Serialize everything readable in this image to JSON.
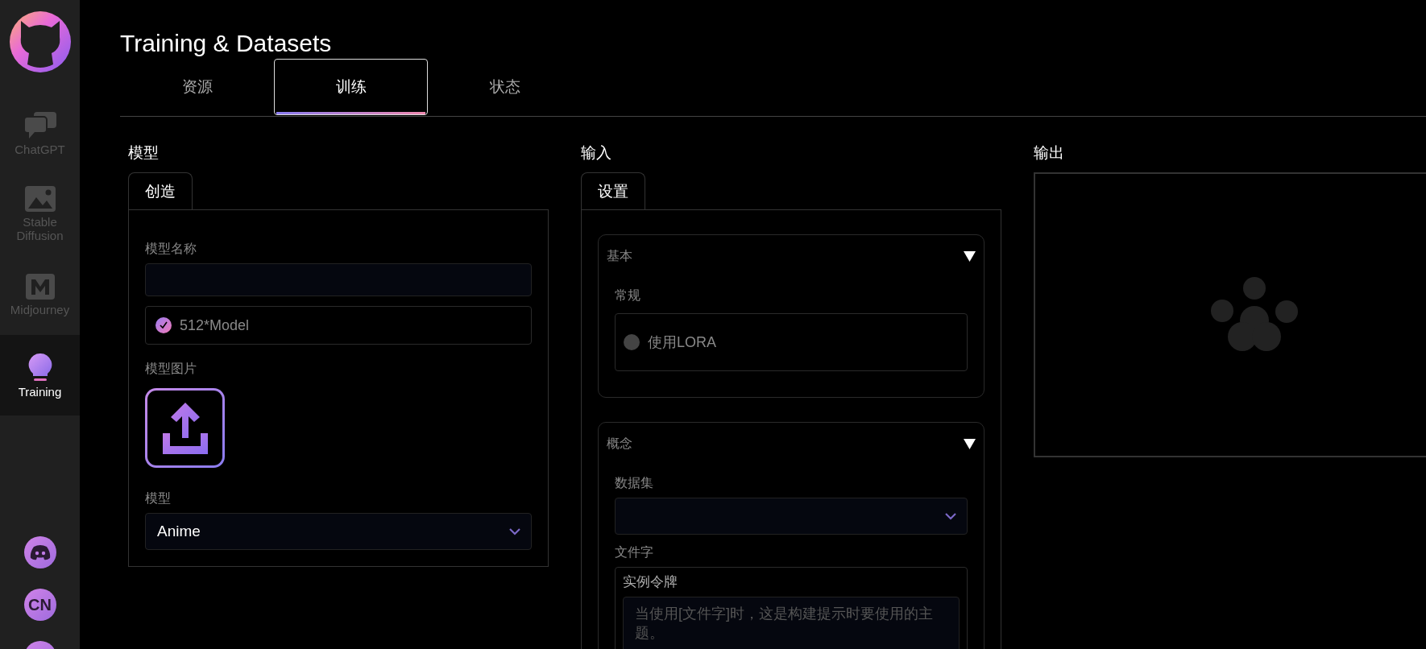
{
  "sidebar": {
    "nav": [
      {
        "kind": "chat",
        "label": "ChatGPT",
        "selected": false
      },
      {
        "kind": "image",
        "label": "Stable Diffusion",
        "selected": false
      },
      {
        "kind": "m",
        "label": "Midjourney",
        "selected": false
      },
      {
        "kind": "bulb",
        "label": "Training",
        "selected": true
      }
    ],
    "bottom": [
      {
        "kind": "discord"
      },
      {
        "kind": "text",
        "label": "CN"
      },
      {
        "kind": "circle"
      }
    ]
  },
  "page_title": "Training & Datasets",
  "tabs": [
    {
      "label": "资源",
      "selected": false
    },
    {
      "label": "训练",
      "selected": true
    },
    {
      "label": "状态",
      "selected": false
    }
  ],
  "model_column": {
    "heading": "模型",
    "tabs": [
      {
        "label": "创造",
        "selected": true
      }
    ],
    "name_field": {
      "label": "模型名称"
    },
    "option": {
      "label": "512*Model",
      "checked": true
    },
    "image_label": "模型图片",
    "model_select": {
      "label": "模型",
      "value": "Anime"
    }
  },
  "input_column": {
    "heading": "输入",
    "tabs": [
      {
        "label": "设置",
        "selected": true
      }
    ],
    "sections": [
      {
        "title": "基本",
        "expanded": true,
        "fields": [
          {
            "kind": "toggle",
            "label": "常规",
            "option": "使用LORA",
            "checked": false
          }
        ]
      },
      {
        "title": "概念",
        "expanded": true,
        "fields": [
          {
            "kind": "select",
            "label": "数据集"
          },
          {
            "kind": "group",
            "label": "文件字",
            "fields": [
              {
                "kind": "textarea",
                "label": "实例令牌",
                "placeholder": "当使用[文件字]时，这是构建提示时要使用的主题。"
              }
            ]
          }
        ]
      }
    ]
  },
  "output_column": {
    "heading": "输出"
  }
}
